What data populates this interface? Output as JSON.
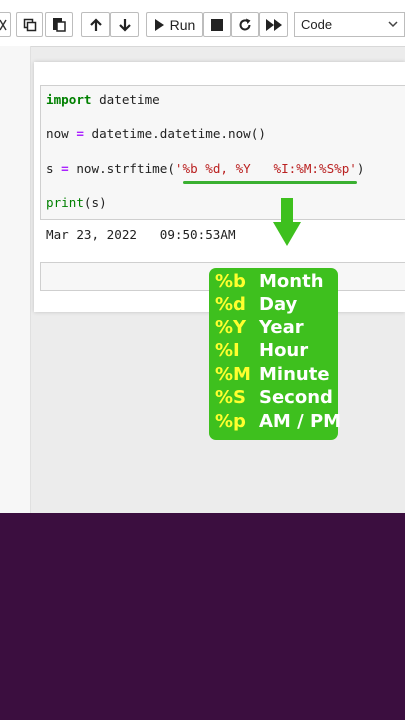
{
  "toolbar": {
    "run_label": "Run",
    "cell_type": "Code"
  },
  "cell": {
    "line1": {
      "kw": "import",
      "rest": " datetime"
    },
    "line2": {
      "a": "now ",
      "op": "=",
      "b": " datetime.datetime.now()"
    },
    "line3": {
      "a": "s ",
      "op": "=",
      "b": " now.strftime(",
      "str": "'%b %d, %Y   %I:%M:%S%p'",
      "c": ")"
    },
    "line4": {
      "fn": "print",
      "rest": "(s)"
    }
  },
  "output": "Mar 23, 2022   09:50:53AM",
  "legend": [
    {
      "code": "%b",
      "label": "Month"
    },
    {
      "code": "%d",
      "label": "Day"
    },
    {
      "code": "%Y",
      "label": "Year"
    },
    {
      "code": "%I",
      "label": "Hour"
    },
    {
      "code": "%M",
      "label": "Minute"
    },
    {
      "code": "%S",
      "label": "Second"
    },
    {
      "code": "%p",
      "label": "AM / PM"
    }
  ],
  "colors": {
    "highlight_green": "#3ec01e",
    "code_yellow": "#ffff2e",
    "background_purple": "#3b0e3f"
  }
}
